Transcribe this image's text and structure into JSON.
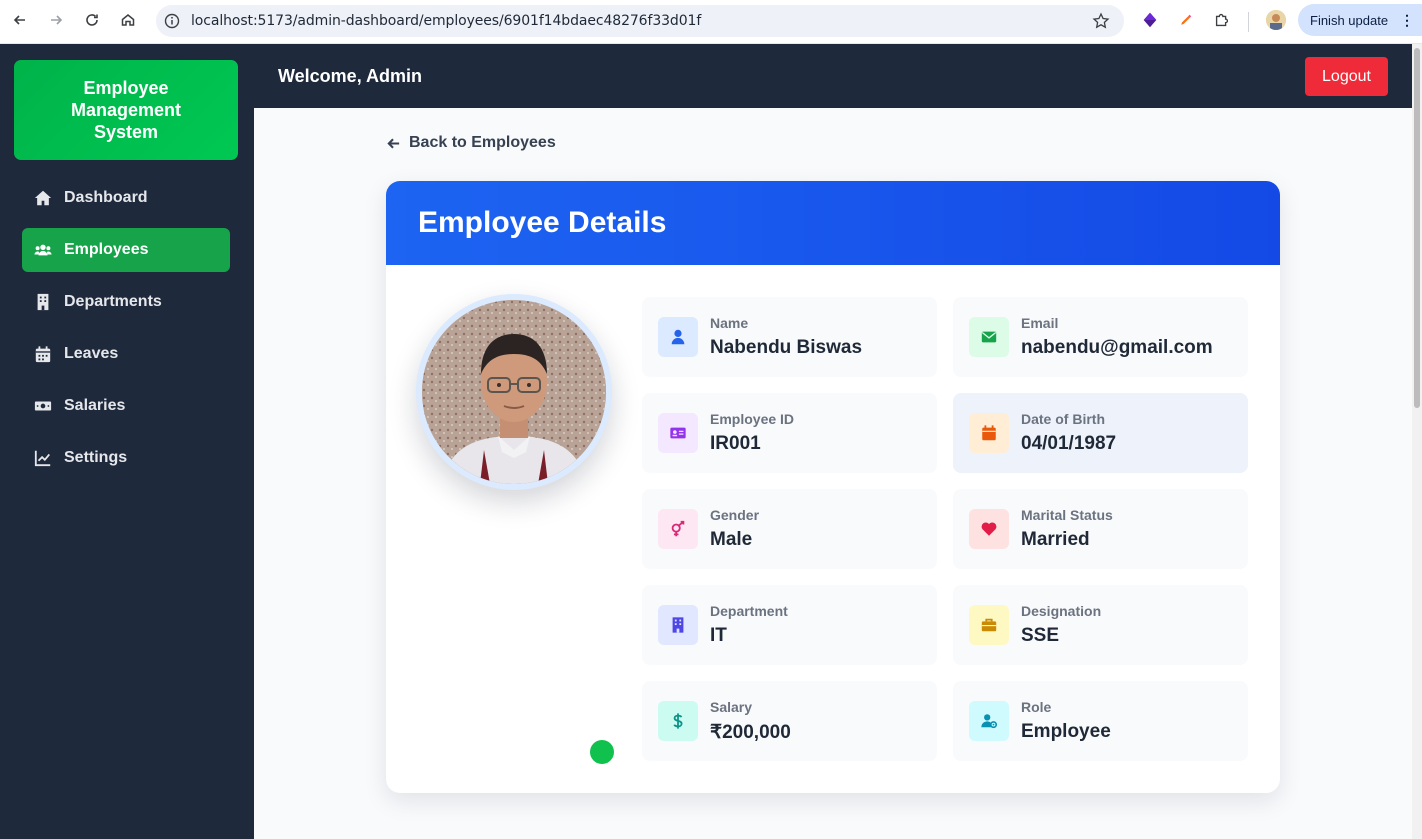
{
  "browser": {
    "url": "localhost:5173/admin-dashboard/employees/6901f14bdaec48276f33d01f",
    "update_button": "Finish update"
  },
  "sidebar": {
    "brand": "Employee Management System",
    "items": [
      {
        "label": "Dashboard",
        "icon": "home-icon",
        "active": false
      },
      {
        "label": "Employees",
        "icon": "users-icon",
        "active": true
      },
      {
        "label": "Departments",
        "icon": "building-icon",
        "active": false
      },
      {
        "label": "Leaves",
        "icon": "calendar-icon",
        "active": false
      },
      {
        "label": "Salaries",
        "icon": "money-icon",
        "active": false
      },
      {
        "label": "Settings",
        "icon": "chart-line-icon",
        "active": false
      }
    ]
  },
  "header": {
    "welcome": "Welcome, Admin",
    "logout": "Logout"
  },
  "main": {
    "back_link": "Back to Employees",
    "card_title": "Employee Details",
    "fields": [
      {
        "label": "Name",
        "value": "Nabendu Biswas",
        "icon": "user-icon",
        "color": "#2563eb"
      },
      {
        "label": "Email",
        "value": "nabendu@gmail.com",
        "icon": "envelope-icon",
        "color": "#16a34a"
      },
      {
        "label": "Employee ID",
        "value": "IR001",
        "icon": "id-card-icon",
        "color": "#9333ea"
      },
      {
        "label": "Date of Birth",
        "value": "04/01/1987",
        "icon": "calendar-icon",
        "color": "#ea580c"
      },
      {
        "label": "Gender",
        "value": "Male",
        "icon": "gender-icon",
        "color": "#db2777"
      },
      {
        "label": "Marital Status",
        "value": "Married",
        "icon": "heart-icon",
        "color": "#e11d48"
      },
      {
        "label": "Department",
        "value": "IT",
        "icon": "building-icon",
        "color": "#4f46e5"
      },
      {
        "label": "Designation",
        "value": "SSE",
        "icon": "briefcase-icon",
        "color": "#ca8a04"
      },
      {
        "label": "Salary",
        "value": "₹200,000",
        "icon": "dollar-icon",
        "color": "#0d9488"
      },
      {
        "label": "Role",
        "value": "Employee",
        "icon": "user-gear-icon",
        "color": "#0891b2"
      }
    ]
  },
  "colors": {
    "sidebar_bg": "#1e293b",
    "accent_green": "#16a34a",
    "header_blue": "#1d64f2",
    "logout_red": "#ef2b39"
  }
}
